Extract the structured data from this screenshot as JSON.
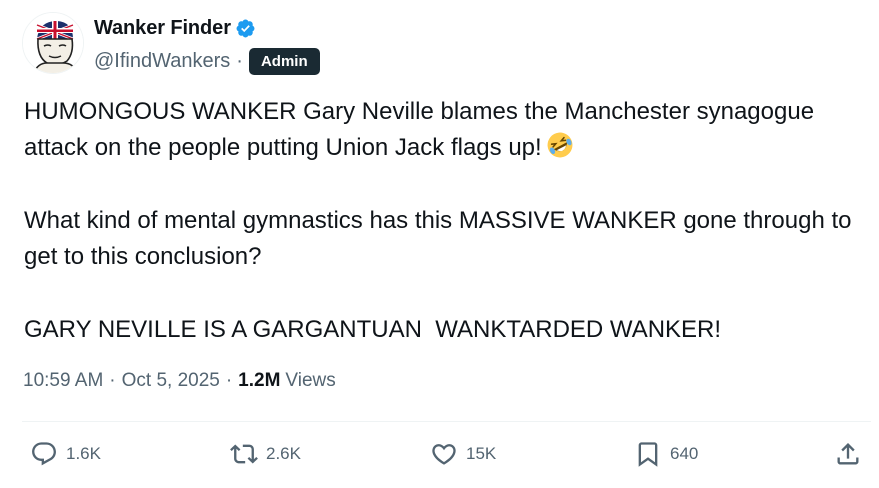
{
  "author": {
    "display_name": "Wanker Finder",
    "handle": "@IfindWankers",
    "separator": "·",
    "badge": "Admin",
    "verified_icon": "verified-badge-icon",
    "verified_color": "#1d9bf0"
  },
  "tweet": {
    "paragraphs": [
      "HUMONGOUS WANKER Gary Neville blames the Manchester synagogue attack on the people putting Union Jack flags up!",
      "What kind of mental gymnastics has this MASSIVE WANKER gone through to get to this conclusion?",
      "GARY NEVILLE IS A GARGANTUAN  WANKTARDED WANKER!"
    ],
    "emoji": "rolling-on-floor-laughing-emoji"
  },
  "meta": {
    "time": "10:59 AM",
    "date": "Oct 5, 2025",
    "sep": "·",
    "views_count": "1.2M",
    "views_label": "Views"
  },
  "actions": {
    "replies": "1.6K",
    "reposts": "2.6K",
    "likes": "15K",
    "bookmarks": "640"
  },
  "colors": {
    "text": "#0f1419",
    "secondary": "#536471",
    "badge_bg": "#1a2a33",
    "divider": "#eff3f4"
  }
}
